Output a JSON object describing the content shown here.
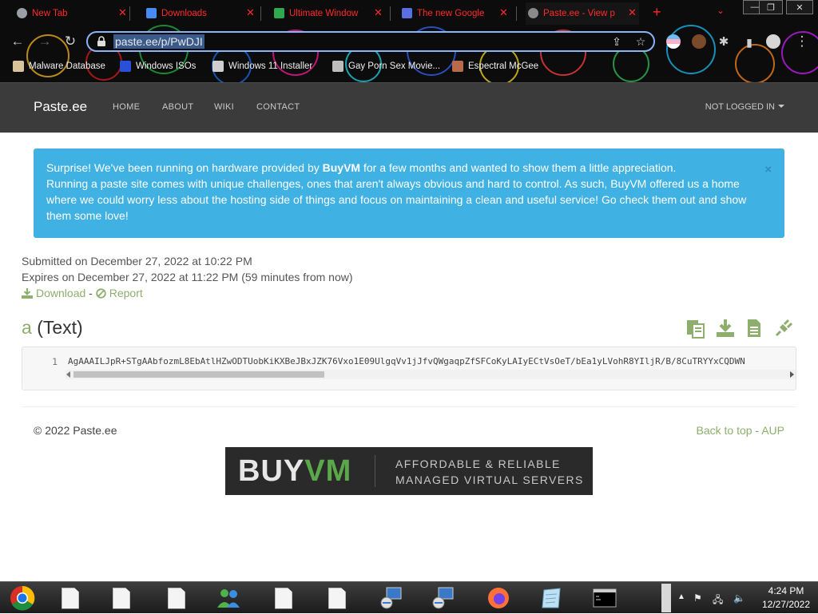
{
  "browser": {
    "tabs": [
      {
        "title": "New Tab",
        "favicon_color": "#9aa0a6"
      },
      {
        "title": "Downloads",
        "favicon_color": "#4a8af4"
      },
      {
        "title": "Ultimate Window",
        "favicon_color": "#2fa84f"
      },
      {
        "title": "The new Google",
        "favicon_color": "#5b6ee1"
      },
      {
        "title": "Paste.ee - View p",
        "favicon_color": "#8a8a8a"
      }
    ],
    "new_tab": "+",
    "tab_search": "⌄",
    "window_controls": {
      "minimize": "—",
      "maximize": "❐",
      "close": "✕"
    },
    "url": "paste.ee/p/PwDJI",
    "bookmarks": [
      {
        "label": "Malware Database",
        "icon_color": "#d9c39a"
      },
      {
        "label": "Windows ISOs",
        "icon_color": "#2a4fd8"
      },
      {
        "label": "Windows 11 Installer",
        "icon_color": "#cfcfcf"
      },
      {
        "label": "Gay Porn Sex Movie...",
        "icon_color": "#bdbdbd"
      },
      {
        "label": "Espectral McGee",
        "icon_color": "#b86a4a"
      }
    ]
  },
  "site": {
    "brand": "Paste.ee",
    "nav": [
      "HOME",
      "ABOUT",
      "WIKI",
      "CONTACT"
    ],
    "login": "NOT LOGGED IN"
  },
  "alert": {
    "text_before": "Surprise! We've been running on hardware provided by ",
    "brand": "BuyVM",
    "text_after": " for a few months and wanted to show them a little appreciation.",
    "body": "Running a paste site comes with unique challenges, ones that aren't always obvious and hard to control. As such, BuyVM offered us a home where we could worry less about the hosting side of things and focus on maintaining a clean and useful service! Go check them out and show them some love!",
    "close": "×"
  },
  "paste": {
    "submitted": "Submitted on December 27, 2022 at 10:22 PM",
    "expires": "Expires on December 27, 2022 at 11:22 PM (59 minutes from now)",
    "download": "Download",
    "separator": " - ",
    "report": "Report",
    "name": "a",
    "type": "(Text)",
    "line_number": "1",
    "code": "AgAAAILJpR+STgAAbfozmL8EbAtlHZwODTUobKiKXBeJBxJZK76Vxo1E09UlgqVv1jJfvQWgaqpZfSFCoKyLAIyECtVsOeT/bEa1yLVohR8YIljR/B/8CuTRYYxCQDWN"
  },
  "footer": {
    "copyright": "© 2022 Paste.ee",
    "back_to_top": "Back to top",
    "separator": " - ",
    "aup": "AUP"
  },
  "banner": {
    "logo_a": "BUY",
    "logo_b": "VM",
    "tagline_1": "AFFORDABLE & RELIABLE",
    "tagline_2": "MANAGED VIRTUAL SERVERS"
  },
  "taskbar": {
    "time": "4:24 PM",
    "date": "12/27/2022"
  }
}
